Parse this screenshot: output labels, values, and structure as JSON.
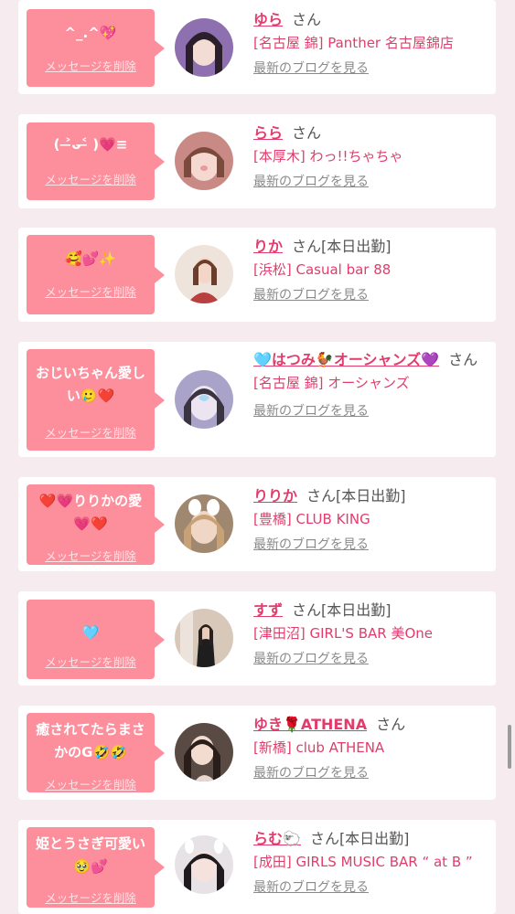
{
  "entries": [
    {
      "message": "^_.^💖",
      "delete_label": "メッセージを削除",
      "name": "ゆら",
      "suffix": "さん",
      "shop": "[名古屋 錦] Panther 名古屋錦店",
      "blog_label": "最新のブログを見る",
      "avatar_color": "#8e6fb0"
    },
    {
      "message": "( ˃̶ᴗ˂̶ )💗≡",
      "delete_label": "メッセージを削除",
      "name": "らら",
      "suffix": "さん",
      "shop": "[本厚木] わっ!!ちゃちゃ",
      "blog_label": "最新のブログを見る",
      "avatar_color": "#c98a86"
    },
    {
      "message": "🥰💕✨",
      "delete_label": "メッセージを削除",
      "name": "りか",
      "suffix": "さん[本日出勤]",
      "shop": "[浜松] Casual bar 88",
      "blog_label": "最新のブログを見る",
      "avatar_color": "#b84040"
    },
    {
      "message": "おじいちゃん愛しい🥲❤️",
      "delete_label": "メッセージを削除",
      "name": "🩵はつみ🐓オーシャンズ💜",
      "suffix": "さん",
      "shop": "[名古屋 錦] オーシャンズ",
      "blog_label": "最新のブログを見る",
      "avatar_color": "#a9a3c9"
    },
    {
      "message": "❤️💗りりかの愛💗❤️",
      "delete_label": "メッセージを削除",
      "name": "りりか",
      "suffix": "さん[本日出勤]",
      "shop": "[豊橋] CLUB KING",
      "blog_label": "最新のブログを見る",
      "avatar_color": "#a08870"
    },
    {
      "message": "🩵",
      "delete_label": "メッセージを削除",
      "name": "すず",
      "suffix": "さん[本日出勤]",
      "shop": "[津田沼] GIRL'S BAR 美One",
      "blog_label": "最新のブログを見る",
      "avatar_color": "#d8c8ba"
    },
    {
      "message": "癒されてたらまさかのG🤣🤣",
      "delete_label": "メッセージを削除",
      "name": "ゆき🌹ATHENA",
      "suffix": "さん",
      "shop": "[新橋] club ATHENA",
      "blog_label": "最新のブログを見る",
      "avatar_color": "#5a4a44"
    },
    {
      "message": "姫とうさぎ可愛い🥹💕",
      "delete_label": "メッセージを削除",
      "name": "らむ🐑",
      "suffix": "さん[本日出勤]",
      "shop": "[成田] GIRLS MUSIC BAR “ at B ”",
      "blog_label": "最新のブログを見る",
      "avatar_color": "#4d4d55"
    }
  ],
  "colors": {
    "bubble": "#fd8f9d",
    "name": "#e23c6c",
    "background": "#f6ecef"
  }
}
